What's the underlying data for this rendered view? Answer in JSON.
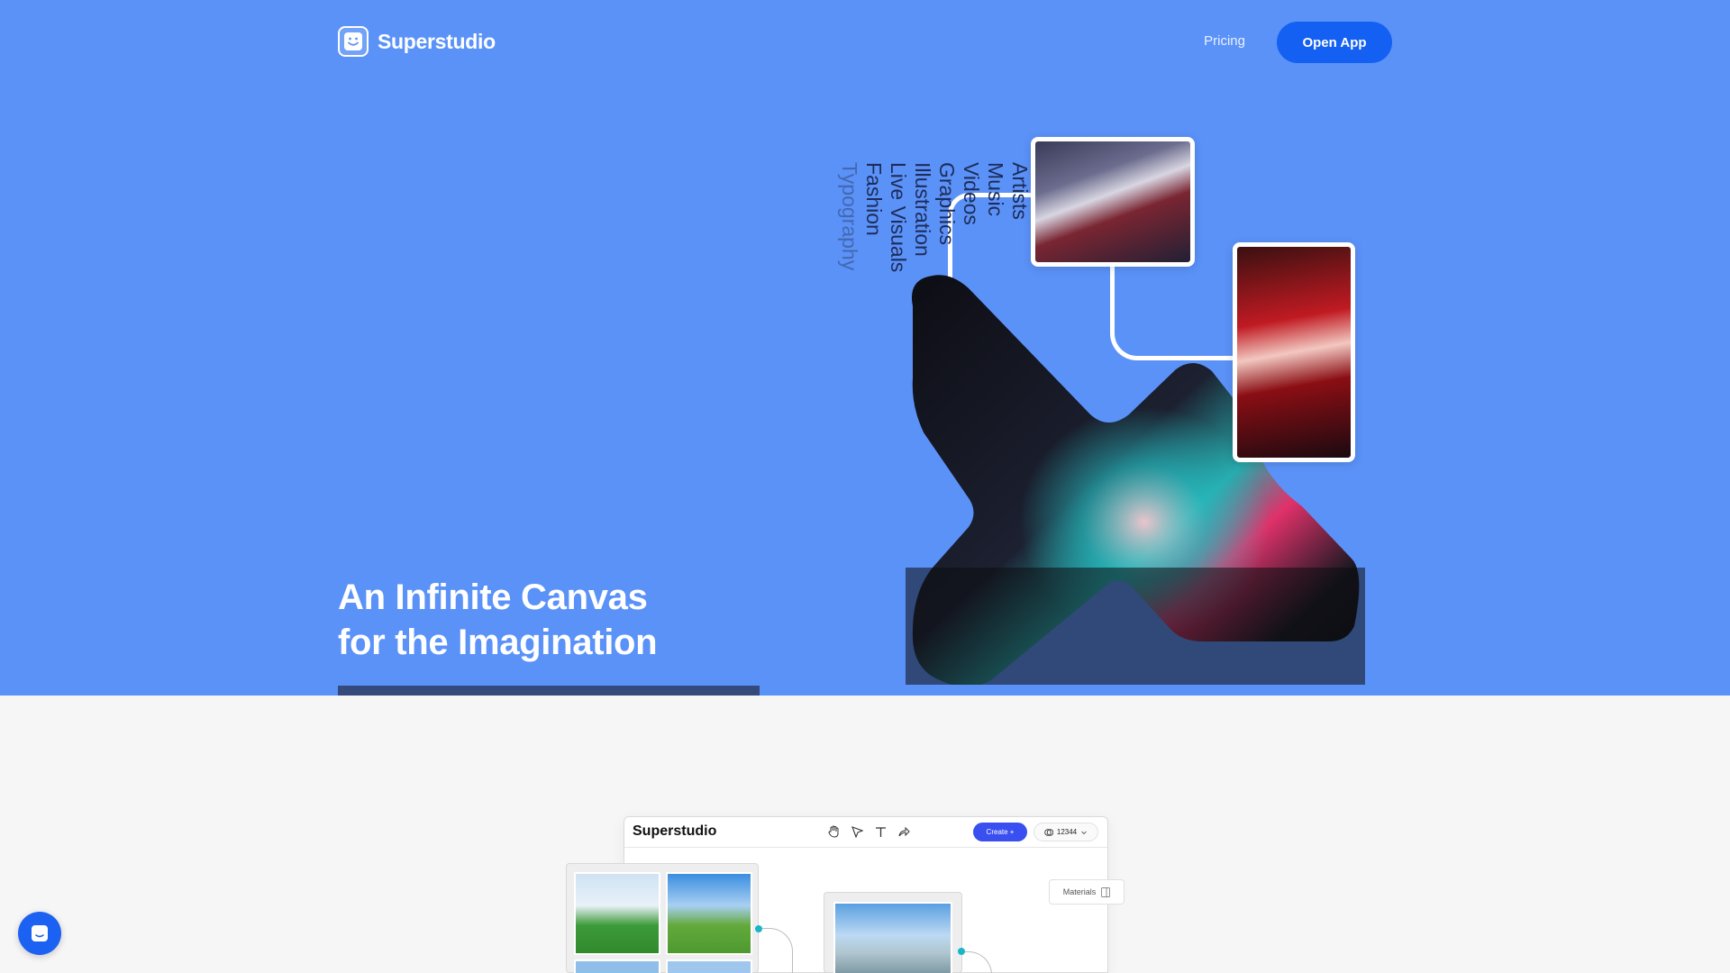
{
  "nav": {
    "brand": "Superstudio",
    "pricing_label": "Pricing",
    "open_app_label": "Open App"
  },
  "hero": {
    "headline_line1": "An Infinite Canvas",
    "headline_line2": "for the Imagination",
    "words": [
      "Artists",
      "Music",
      "Videos",
      "Graphics",
      "Illustration",
      "Live Visuals",
      "Fashion",
      "Typography"
    ]
  },
  "app_preview": {
    "app_name": "Superstudio",
    "create_label": "Create  +",
    "credits_value": "12344",
    "materials_label": "Materials"
  },
  "colors": {
    "hero_bg": "#5b92f8",
    "primary_button": "#1360f2",
    "create_button": "#3a4ff0",
    "connector_dot": "#18b6c8"
  },
  "icons": {
    "logo": "smiley-face-icon",
    "tools": [
      "hand-icon",
      "pointer-icon",
      "text-icon",
      "share-icon"
    ],
    "credits": "coins-icon",
    "chevron": "chevron-down-icon",
    "materials": "panel-icon",
    "chat": "chat-icon"
  }
}
